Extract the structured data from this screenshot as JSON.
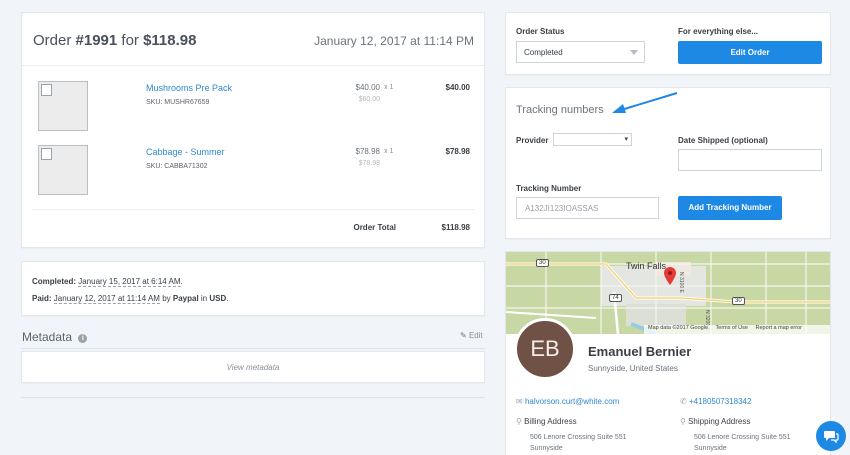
{
  "order": {
    "title_prefix": "Order ",
    "number": "#1991",
    "title_mid": " for ",
    "amount": "$118.98",
    "date": "January 12, 2017 at 11:14 PM",
    "items": [
      {
        "name": "Mushrooms Pre Pack",
        "sku": "SKU: MUSHR67659",
        "price": "$40.00",
        "qty": "x 1",
        "original": "$60.00",
        "total": "$40.00"
      },
      {
        "name": "Cabbage - Summer",
        "sku": "SKU: CABBA71302",
        "price": "$78.98",
        "qty": "x 1",
        "original": "$78.98",
        "total": "$78.98"
      }
    ],
    "total_label": "Order Total",
    "total_value": "$118.98"
  },
  "status_card": {
    "completed_label": "Completed:",
    "completed_date": "January 15, 2017 at 6:14 AM",
    "paid_label": "Paid:",
    "paid_date": "January 12, 2017 at 11:14 AM",
    "by": "by",
    "method": "Paypal",
    "in": "in",
    "currency": "USD",
    "period": "."
  },
  "metadata": {
    "heading": "Metadata",
    "edit": "Edit",
    "view": "View metadata"
  },
  "order_status": {
    "label": "Order Status",
    "value": "Completed",
    "else_label": "For everything else...",
    "edit_button": "Edit Order"
  },
  "tracking": {
    "heading": "Tracking numbers",
    "provider_label": "Provider",
    "date_label": "Date Shipped (optional)",
    "number_label": "Tracking Number",
    "number_value": "A132JI123IOASSAS",
    "add_button": "Add Tracking Number"
  },
  "map": {
    "city": "Twin Falls",
    "road_1": "30",
    "road_2": "30",
    "road_3": "74",
    "road_4": "N 3100 E",
    "road_5": "N 3200 E",
    "attribution": "Map data ©2017 Google",
    "terms": "Terms of Use",
    "report": "Report a map error"
  },
  "customer": {
    "initials": "EB",
    "name": "Emanuel Bernier",
    "location": "Sunnyside, United States",
    "email": "halvorson.curt@white.com",
    "phone": "+4180507318342",
    "billing_label": "Billing Address",
    "billing_line1": "506 Lenore Crossing Suite 551",
    "billing_line2": "Sunnyside",
    "shipping_label": "Shipping Address",
    "shipping_line1": "506 Lenore Crossing Suite 551",
    "shipping_line2": "Sunnyside"
  },
  "colors": {
    "accent": "#1e88e5",
    "link": "#2f87d0",
    "avatar": "#6f5145",
    "map_land": "#c8d8a4"
  }
}
